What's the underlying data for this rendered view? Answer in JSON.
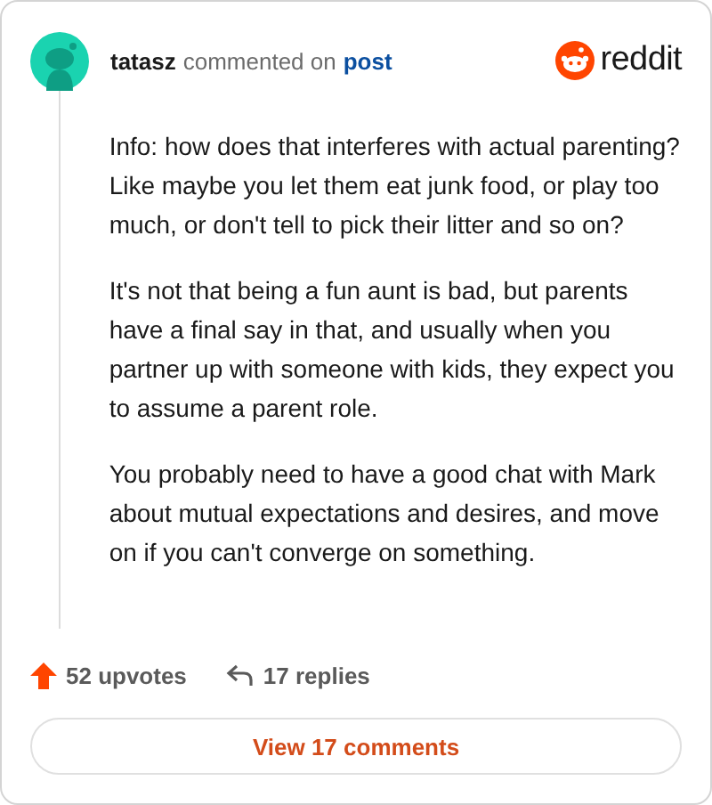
{
  "header": {
    "username": "tatasz",
    "action": "commented on",
    "link": "post",
    "brand": "reddit"
  },
  "paragraphs": [
    "Info: how does that interferes with actual parenting? Like maybe you let them eat junk food, or play too much, or don't tell to pick their litter and so on?",
    "It's not that being a fun aunt is bad, but parents have a final say in that, and usually when you partner up with someone with kids, they expect you to assume a parent role.",
    "You probably need to have a good chat with Mark about mutual expectations and desires, and move on if you can't converge on something."
  ],
  "footer": {
    "upvotes": "52 upvotes",
    "replies": "17 replies"
  },
  "button": "View 17 comments"
}
